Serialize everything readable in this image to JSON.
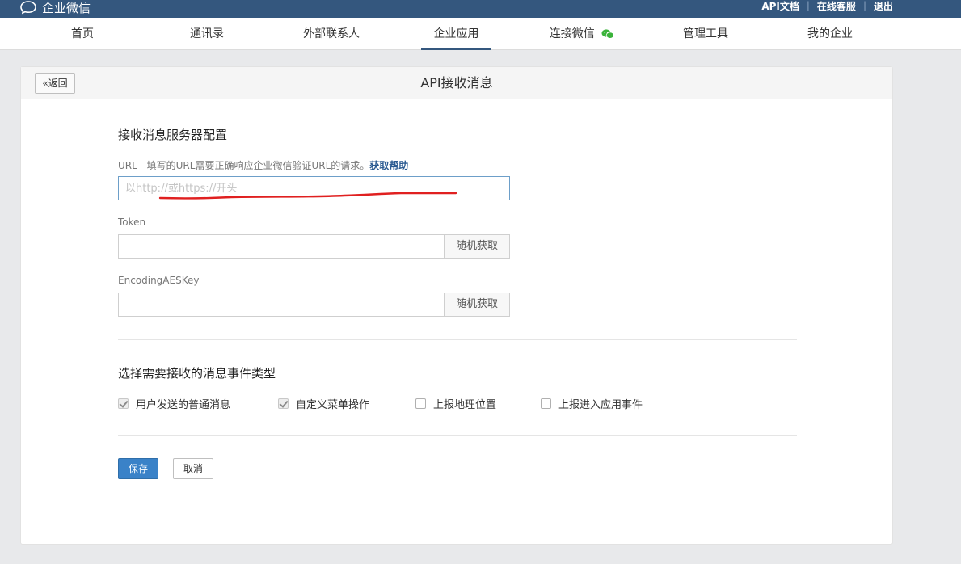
{
  "topbar": {
    "brand": "企业微信",
    "links": [
      "API文档",
      "在线客服",
      "退出"
    ],
    "separator": "|"
  },
  "nav": {
    "items": [
      {
        "label": "首页"
      },
      {
        "label": "通讯录"
      },
      {
        "label": "外部联系人"
      },
      {
        "label": "企业应用",
        "active": true
      },
      {
        "label": "连接微信"
      },
      {
        "label": "管理工具"
      },
      {
        "label": "我的企业"
      }
    ]
  },
  "panel": {
    "back_label": "«返回",
    "title": "API接收消息"
  },
  "server_config": {
    "title": "接收消息服务器配置",
    "url_label": "URL",
    "url_hint": "填写的URL需要正确响应企业微信验证URL的请求。",
    "help_link": "获取帮助",
    "url_placeholder": "以http://或https://开头",
    "token_label": "Token",
    "token_value": "",
    "aes_label": "EncodingAESKey",
    "aes_value": "",
    "random_label": "随机获取"
  },
  "events": {
    "title": "选择需要接收的消息事件类型",
    "options": [
      {
        "label": "用户发送的普通消息",
        "checked": true
      },
      {
        "label": "自定义菜单操作",
        "checked": true
      },
      {
        "label": "上报地理位置",
        "checked": false
      },
      {
        "label": "上报进入应用事件",
        "checked": false
      }
    ]
  },
  "actions": {
    "save": "保存",
    "cancel": "取消"
  },
  "colors": {
    "topbar": "#34577e",
    "primary_button": "#3a82c8",
    "annotation_red": "#e02020"
  }
}
